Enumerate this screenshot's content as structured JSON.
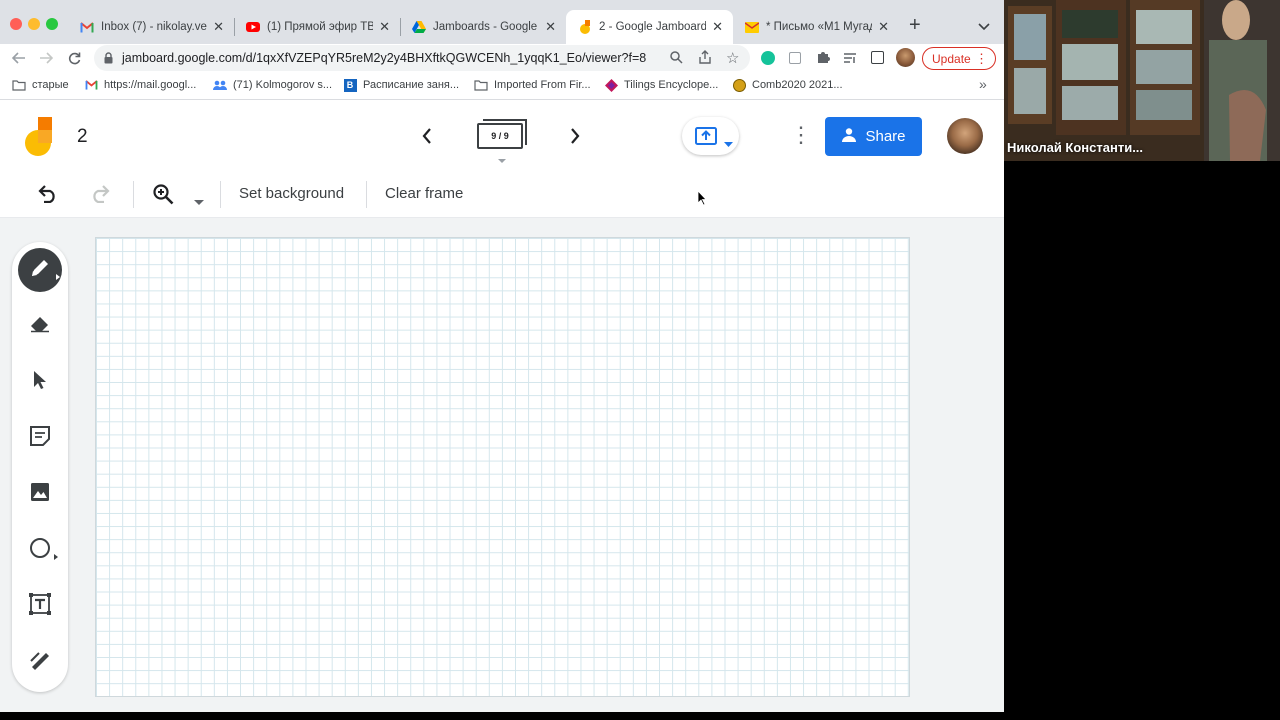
{
  "browser": {
    "tabs": [
      {
        "title": "Inbox (7) - nikolay.vere",
        "icon": "gmail-icon",
        "active": false
      },
      {
        "title": "(1) Прямой эфир ТВ-к",
        "icon": "youtube-icon",
        "active": false
      },
      {
        "title": "Jamboards - Google D",
        "icon": "google-drive-icon",
        "active": false
      },
      {
        "title": "2 - Google Jamboard",
        "icon": "jamboard-icon",
        "active": true
      },
      {
        "title": "* Письмо «M1 Мугад",
        "icon": "mail-icon",
        "active": false
      }
    ],
    "new_tab_label": "+",
    "url": "jamboard.google.com/d/1qxXfVZEPqYR5reM2y2y4BHXftkQGWCENh_1yqqK1_Eo/viewer?f=8",
    "update_label": "Update",
    "bookmarks": [
      {
        "label": "старые",
        "icon": "folder-icon"
      },
      {
        "label": "https://mail.googl...",
        "icon": "gmail-icon"
      },
      {
        "label": "(71) Kolmogorov s...",
        "icon": "people-icon"
      },
      {
        "label": "Расписание заня...",
        "icon": "b-icon"
      },
      {
        "label": "Imported From Fir...",
        "icon": "folder-icon"
      },
      {
        "label": "Tilings Encyclope...",
        "icon": "tiling-icon"
      },
      {
        "label": "Comb2020 2021...",
        "icon": "comb-icon"
      }
    ],
    "more_bookmarks": "»"
  },
  "jamboard": {
    "title": "2",
    "frame_indicator": "9 / 9",
    "share_label": "Share",
    "toolbar": {
      "set_background": "Set background",
      "clear_frame": "Clear frame"
    },
    "tools": [
      "pen",
      "eraser",
      "select",
      "sticky-note",
      "image",
      "circle",
      "text-box",
      "laser"
    ],
    "active_tool": "pen"
  },
  "video": {
    "participant_name": "Николай Константи..."
  },
  "colors": {
    "accent": "#1a73e8",
    "update": "#d93025",
    "grid": "#d4e6ec"
  }
}
